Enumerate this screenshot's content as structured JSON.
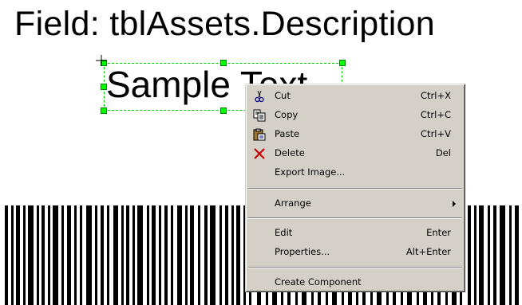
{
  "canvas": {
    "field_title": "Field: tblAssets.Description",
    "sample_text": "Sample Text"
  },
  "colors": {
    "selection": "#00cc00",
    "handle": "#00ff00",
    "menu_bg": "#d4d0c8"
  },
  "context_menu": {
    "items": [
      {
        "label": "Cut",
        "shortcut": "Ctrl+X",
        "icon": "scissors-icon"
      },
      {
        "label": "Copy",
        "shortcut": "Ctrl+C",
        "icon": "copy-icon"
      },
      {
        "label": "Paste",
        "shortcut": "Ctrl+V",
        "icon": "paste-icon"
      },
      {
        "label": "Delete",
        "shortcut": "Del",
        "icon": "delete-x-icon"
      },
      {
        "label": "Export Image...",
        "shortcut": ""
      },
      {
        "label": "Arrange",
        "shortcut": "",
        "submenu": true
      },
      {
        "label": "Edit",
        "shortcut": "Enter"
      },
      {
        "label": "Properties...",
        "shortcut": "Alt+Enter"
      },
      {
        "label": "Create Component",
        "shortcut": ""
      }
    ]
  }
}
